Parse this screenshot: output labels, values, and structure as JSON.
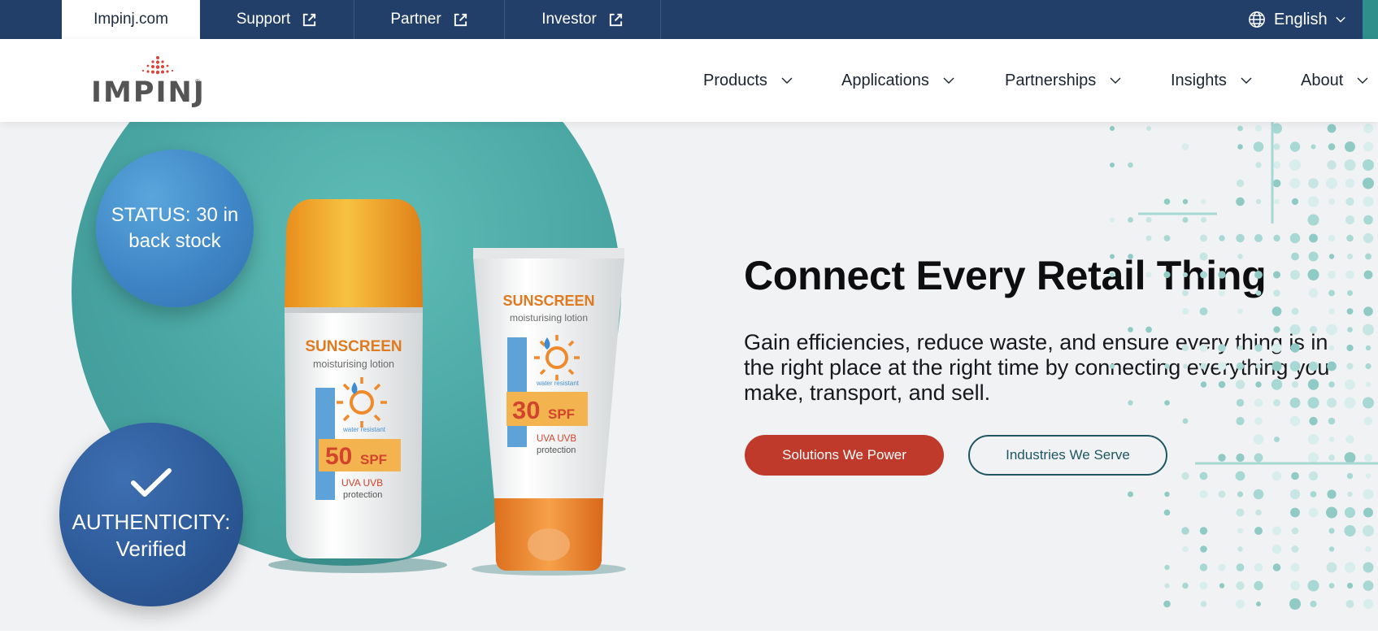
{
  "topbar": {
    "tabs": [
      {
        "label": "Impinj.com",
        "active": true,
        "external": false
      },
      {
        "label": "Support",
        "active": false,
        "external": true
      },
      {
        "label": "Partner",
        "active": false,
        "external": true
      },
      {
        "label": "Investor",
        "active": false,
        "external": true
      }
    ],
    "language": "English"
  },
  "nav": {
    "logo_text": "IMPINJ",
    "logo_mark": "®",
    "items": [
      {
        "label": "Products"
      },
      {
        "label": "Applications"
      },
      {
        "label": "Partnerships"
      },
      {
        "label": "Insights"
      },
      {
        "label": "About"
      }
    ]
  },
  "hero": {
    "badge_status": "STATUS: 30 in back stock",
    "badge_auth_line1": "AUTHENTICITY:",
    "badge_auth_line2": "Verified",
    "headline": "Connect Every Retail Thing",
    "lede": "Gain efficiencies, reduce waste, and ensure every thing is in the right place at the right time by connecting everything you make, transport, and sell.",
    "buttons": {
      "solutions": "Solutions We Power",
      "industries": "Industries We Serve"
    },
    "products": {
      "bottle": {
        "brand": "SUNSCREEN",
        "subtitle": "moisturising lotion",
        "water": "water resistant",
        "spf_number": "50",
        "spf_unit": "SPF",
        "protection_1": "UVA UVB",
        "protection_2": "protection"
      },
      "tube": {
        "brand": "SUNSCREEN",
        "subtitle": "moisturising lotion",
        "water": "water resistant",
        "spf_number": "30",
        "spf_unit": "SPF",
        "protection_1": "UVA  UVB",
        "protection_2": "protection"
      }
    }
  },
  "colors": {
    "topbar": "#223f69",
    "accent_red": "#c03a2b",
    "teal": "#48a5a2",
    "outline_button": "#1f5661",
    "status_badge": "#3f86c6",
    "auth_badge": "#2d5a99"
  },
  "icons": {
    "external_link": "external-link-icon",
    "globe": "globe-icon",
    "chevron": "chevron-down-icon",
    "check": "check-icon"
  }
}
